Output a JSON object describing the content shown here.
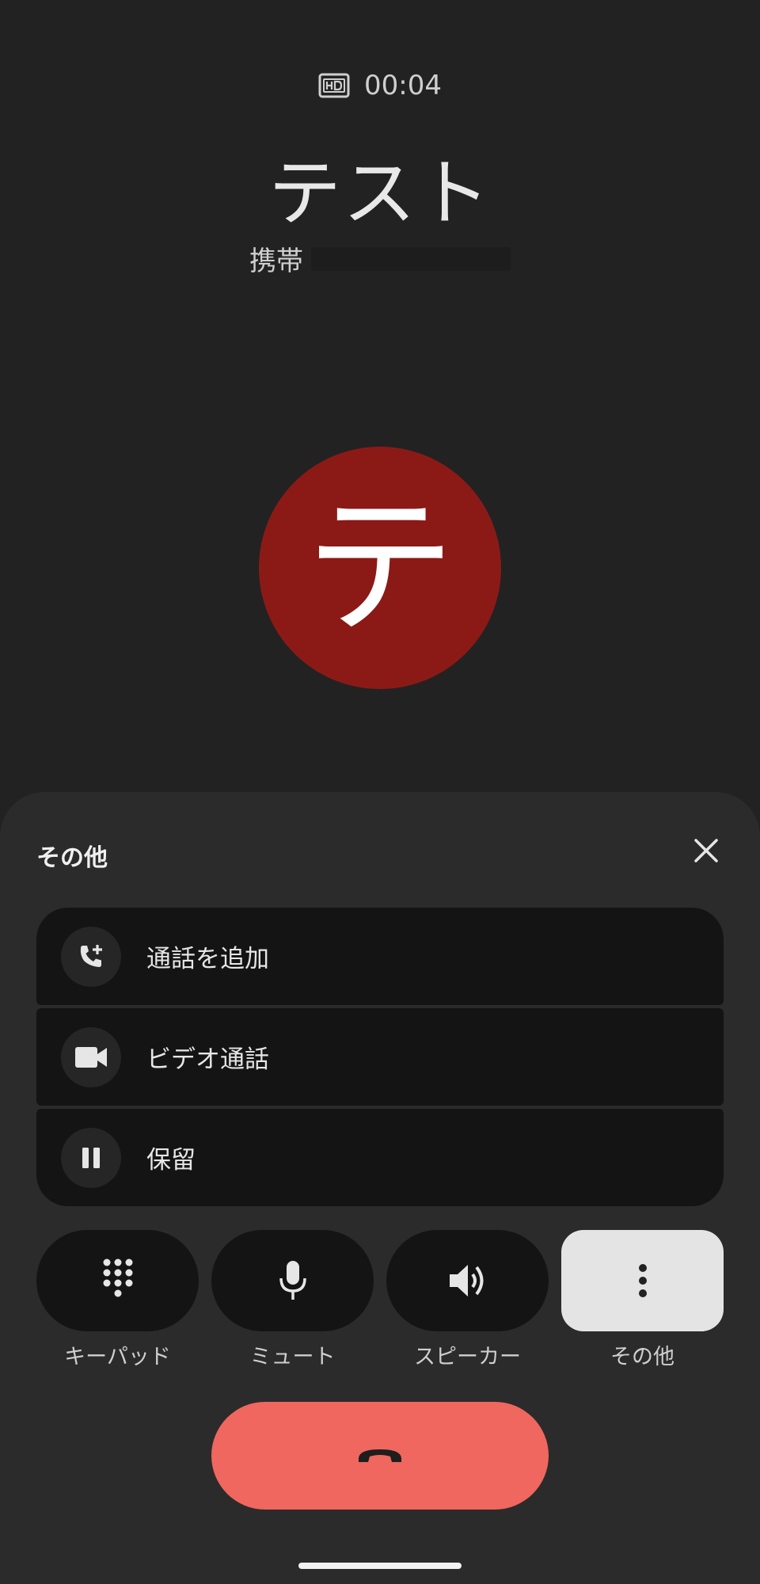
{
  "call": {
    "timer": "00:04",
    "contact_name": "テスト",
    "number_label": "携帯",
    "avatar_initial": "テ",
    "avatar_color": "#8b1a17"
  },
  "sheet": {
    "title": "その他",
    "close_icon": "close-icon",
    "items": [
      {
        "label": "通話を追加",
        "icon": "add-call-icon"
      },
      {
        "label": "ビデオ通話",
        "icon": "videocam-icon"
      },
      {
        "label": "保留",
        "icon": "pause-icon"
      }
    ]
  },
  "controls": [
    {
      "label": "キーパッド",
      "icon": "dialpad-icon",
      "active": false
    },
    {
      "label": "ミュート",
      "icon": "mic-icon",
      "active": false
    },
    {
      "label": "スピーカー",
      "icon": "speaker-icon",
      "active": false
    },
    {
      "label": "その他",
      "icon": "more-vert-icon",
      "active": true
    }
  ],
  "end_call": {
    "icon": "call-end-icon",
    "color": "#ef675e"
  },
  "colors": {
    "background": "#222222",
    "sheet": "#2b2b2b",
    "button": "#141414",
    "active_button": "#e4e4e4"
  }
}
